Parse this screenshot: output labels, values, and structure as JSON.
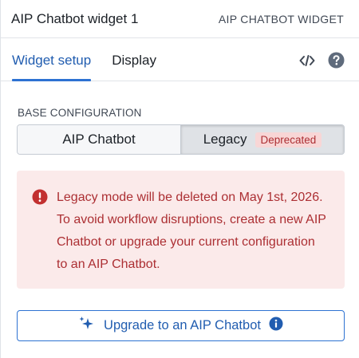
{
  "header": {
    "title": "AIP Chatbot widget 1",
    "widget_type": "AIP CHATBOT WIDGET"
  },
  "tabs": [
    {
      "label": "Widget setup",
      "active": true
    },
    {
      "label": "Display",
      "active": false
    }
  ],
  "tab_icons": [
    "code-icon",
    "help-icon"
  ],
  "base_config": {
    "label": "BASE CONFIGURATION",
    "options": [
      {
        "label": "AIP Chatbot",
        "selected": false
      },
      {
        "label": "Legacy",
        "selected": true,
        "tag": "Deprecated"
      }
    ]
  },
  "callout": {
    "icon": "error-icon",
    "message": "Legacy mode will be deleted on May 1st, 2026. To avoid workflow disruptions, create a new AIP Chatbot or upgrade your current configuration to an AIP Chatbot."
  },
  "upgrade_button": {
    "label": "Upgrade to an AIP Chatbot",
    "icons": [
      "sparkle-icon",
      "info-icon"
    ]
  },
  "colors": {
    "primary": "#2d72d2",
    "primary_text": "#215db0",
    "danger_text": "#ac2f33",
    "danger_bg": "#fbeaea",
    "deprecated_bg": "#f8d6d6"
  }
}
